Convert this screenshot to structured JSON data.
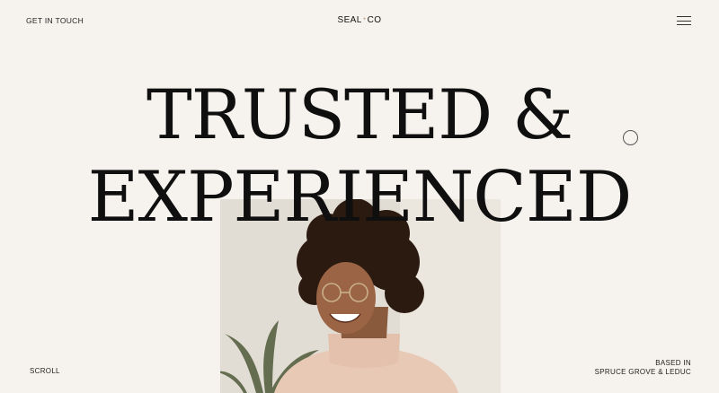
{
  "header": {
    "contact_label": "GET IN TOUCH",
    "logo_left": "SEAL",
    "logo_mark": "+",
    "logo_right": "CO",
    "menu_icon": "hamburger-menu-icon"
  },
  "hero": {
    "line1": "TRUSTED &",
    "line2": "EXPERIENCED"
  },
  "footer": {
    "scroll_label": "SCROLL",
    "based_line1": "BASED IN",
    "based_line2": "SPRUCE GROVE & LEDUC"
  },
  "colors": {
    "background": "#f6f3ee",
    "text": "#0f0f0f",
    "accent": "#b88a6a"
  }
}
